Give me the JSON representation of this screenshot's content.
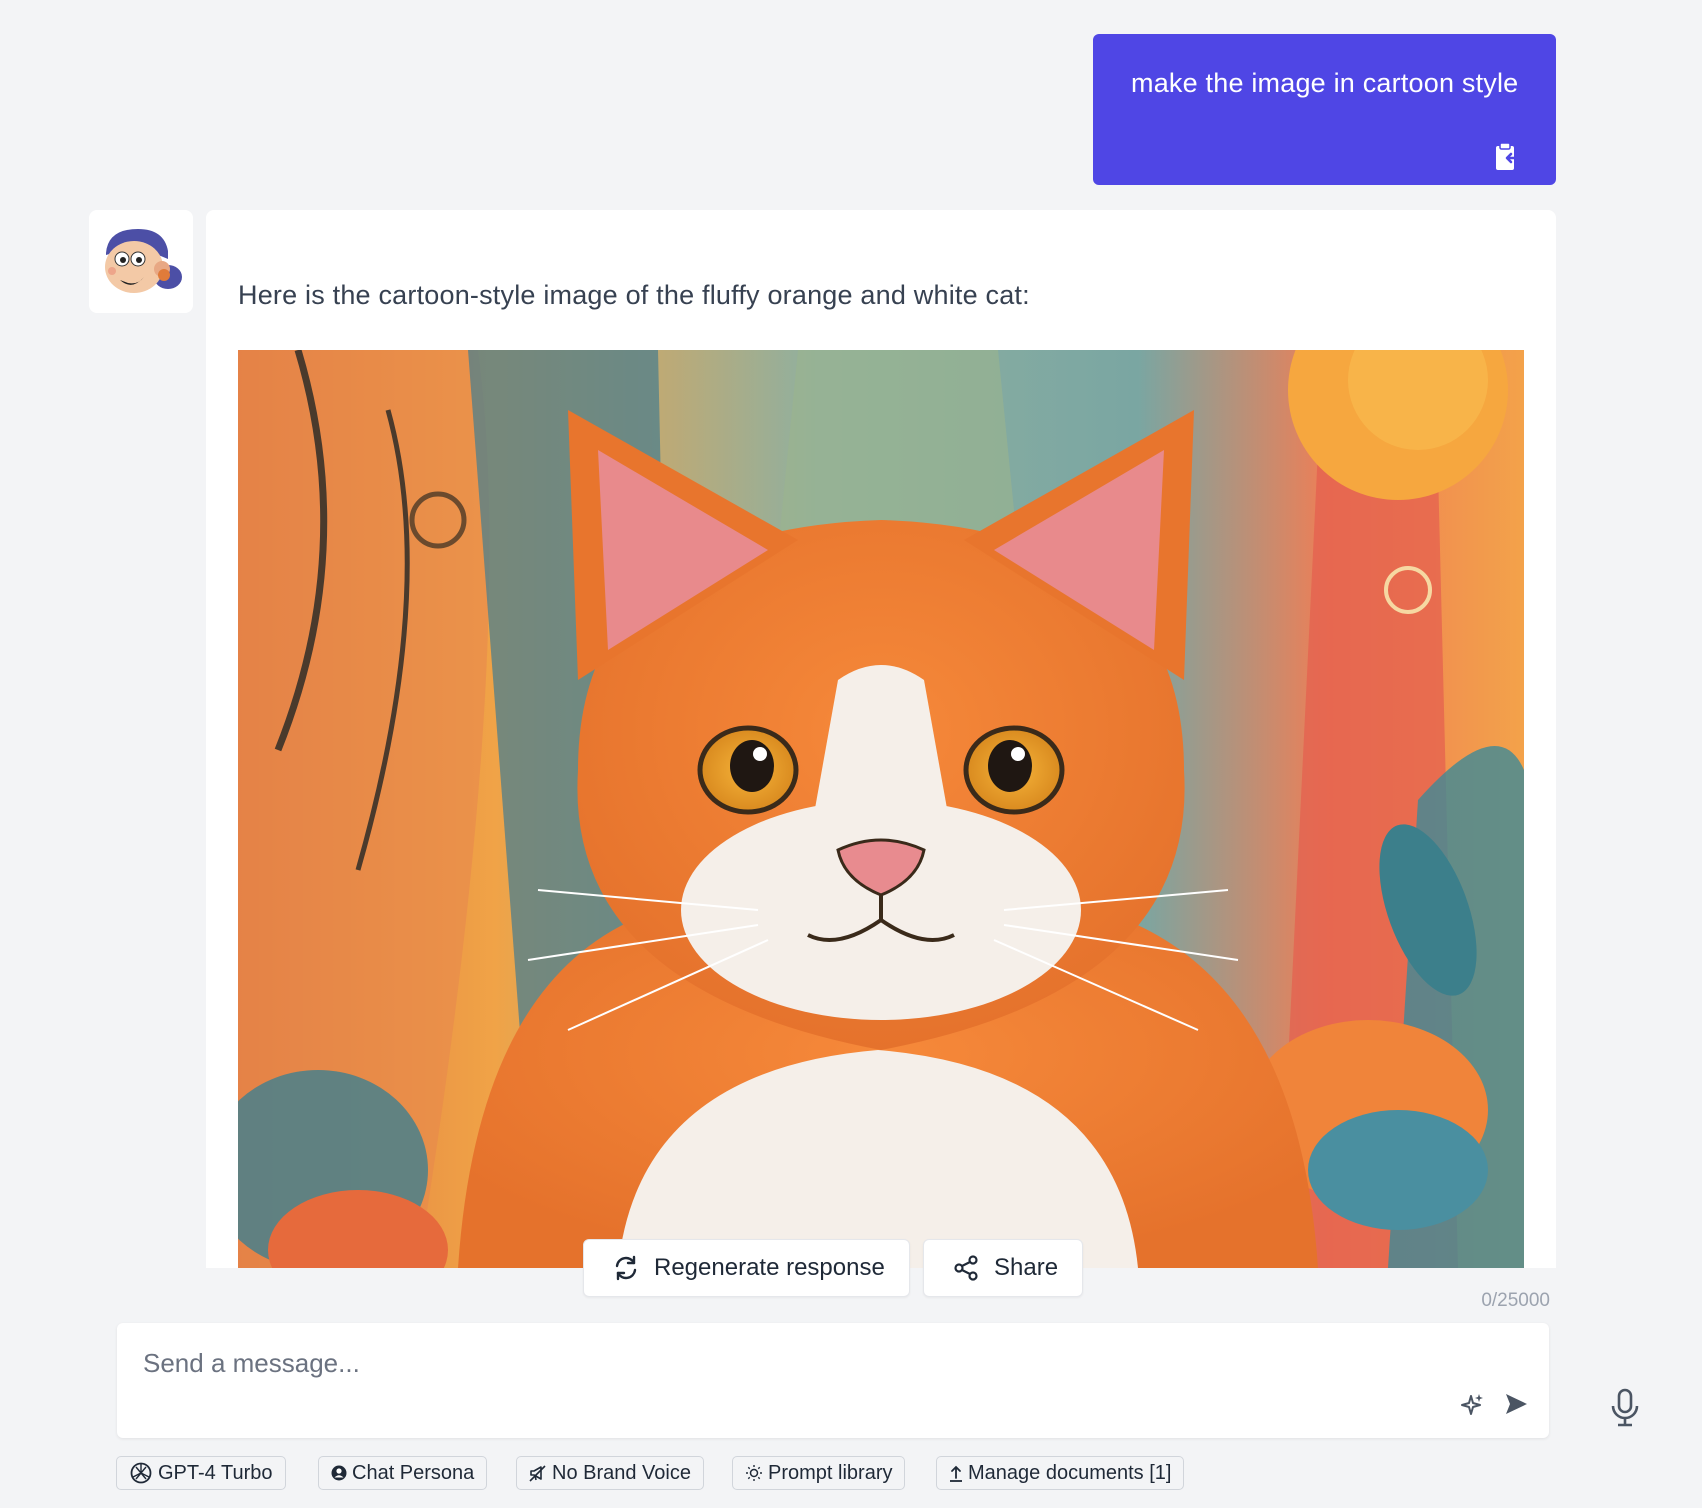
{
  "user_message": {
    "text": "make the image in cartoon style",
    "copy_icon": "clipboard-copy-icon"
  },
  "assistant_message": {
    "avatar_icon": "cartoon-boy-avatar",
    "text": "Here is the cartoon-style image of the fluffy orange and white cat:",
    "image_icon": "cartoon-orange-cat-image"
  },
  "actions": {
    "regenerate_label": "Regenerate response",
    "share_label": "Share"
  },
  "composer": {
    "char_count": "0/25000",
    "placeholder": "Send a message...",
    "value": ""
  },
  "toolbar": {
    "model_label": "GPT-4 Turbo",
    "persona_label": "Chat Persona",
    "brand_voice_label": "No Brand Voice",
    "prompt_library_label": "Prompt library",
    "documents_label": "Manage documents [1]"
  },
  "colors": {
    "accent": "#4f46e5",
    "background": "#f3f4f6"
  }
}
